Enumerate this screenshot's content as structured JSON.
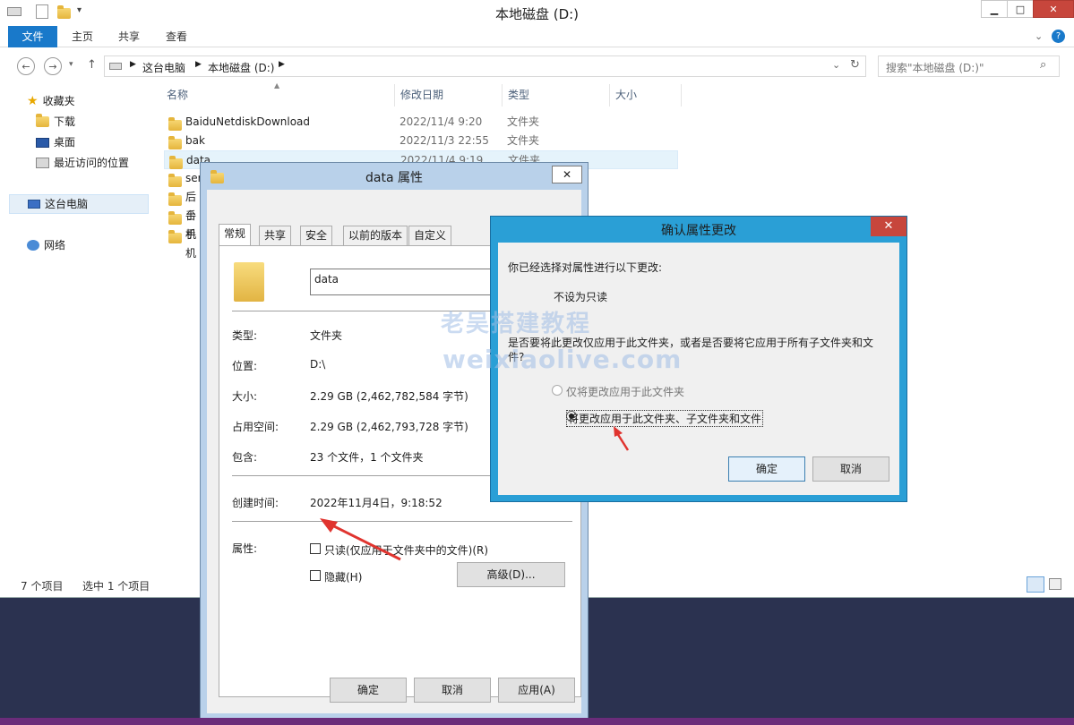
{
  "explorer": {
    "title": "本地磁盘 (D:)",
    "ribbon_tabs": [
      "文件",
      "主页",
      "共享",
      "查看"
    ],
    "breadcrumbs": [
      "这台电脑",
      "本地磁盘 (D:)"
    ],
    "search_placeholder": "搜索\"本地磁盘 (D:)\"",
    "nav": {
      "favorites": "收藏夹",
      "downloads": "下载",
      "desktop": "桌面",
      "recent": "最近访问的位置",
      "this_pc": "这台电脑",
      "network": "网络"
    },
    "columns": [
      "名称",
      "修改日期",
      "类型",
      "大小"
    ],
    "files": [
      {
        "name": "BaiduNetdiskDownload",
        "date": "2022/11/4 9:20",
        "type": "文件夹"
      },
      {
        "name": "bak",
        "date": "2022/11/3 22:55",
        "type": "文件夹"
      },
      {
        "name": "data",
        "date": "2022/11/4 9:19",
        "type": "文件夹"
      },
      {
        "name": "ser",
        "date": "",
        "type": ""
      },
      {
        "name": "后台",
        "date": "",
        "type": ""
      },
      {
        "name": "手机",
        "date": "",
        "type": ""
      },
      {
        "name": "手机",
        "date": "",
        "type": ""
      }
    ],
    "status": {
      "count": "7 个项目",
      "selected": "选中 1 个项目"
    }
  },
  "props": {
    "title": "data 属性",
    "tabs": [
      "常规",
      "共享",
      "安全",
      "以前的版本",
      "自定义"
    ],
    "name_value": "data",
    "rows": [
      {
        "label": "类型:",
        "value": "文件夹"
      },
      {
        "label": "位置:",
        "value": "D:\\"
      },
      {
        "label": "大小:",
        "value": "2.29 GB (2,462,782,584 字节)"
      },
      {
        "label": "占用空间:",
        "value": "2.29 GB (2,462,793,728 字节)"
      },
      {
        "label": "包含:",
        "value": "23 个文件，1 个文件夹"
      }
    ],
    "created_label": "创建时间:",
    "created_value": "2022年11月4日，9:18:52",
    "attr_label": "属性:",
    "readonly_label": "只读(仅应用于文件夹中的文件)(R)",
    "hidden_label": "隐藏(H)",
    "advanced_label": "高级(D)...",
    "ok_label": "确定",
    "cancel_label": "取消",
    "apply_label": "应用(A)"
  },
  "confirm": {
    "title": "确认属性更改",
    "intro": "你已经选择对属性进行以下更改:",
    "change": "不设为只读",
    "question": "是否要将此更改仅应用于此文件夹，或者是否要将它应用于所有子文件夹和文件?",
    "option1": "仅将更改应用于此文件夹",
    "option2": "将更改应用于此文件夹、子文件夹和文件",
    "ok_label": "确定",
    "cancel_label": "取消"
  },
  "watermark": {
    "cn": "老吴搭建教程",
    "en": "weixiaolive.com"
  },
  "colors": {
    "accent": "#1979ca",
    "confirm_frame": "#2a9fd6",
    "close_red": "#c7463c",
    "arrow": "#e0342f"
  }
}
